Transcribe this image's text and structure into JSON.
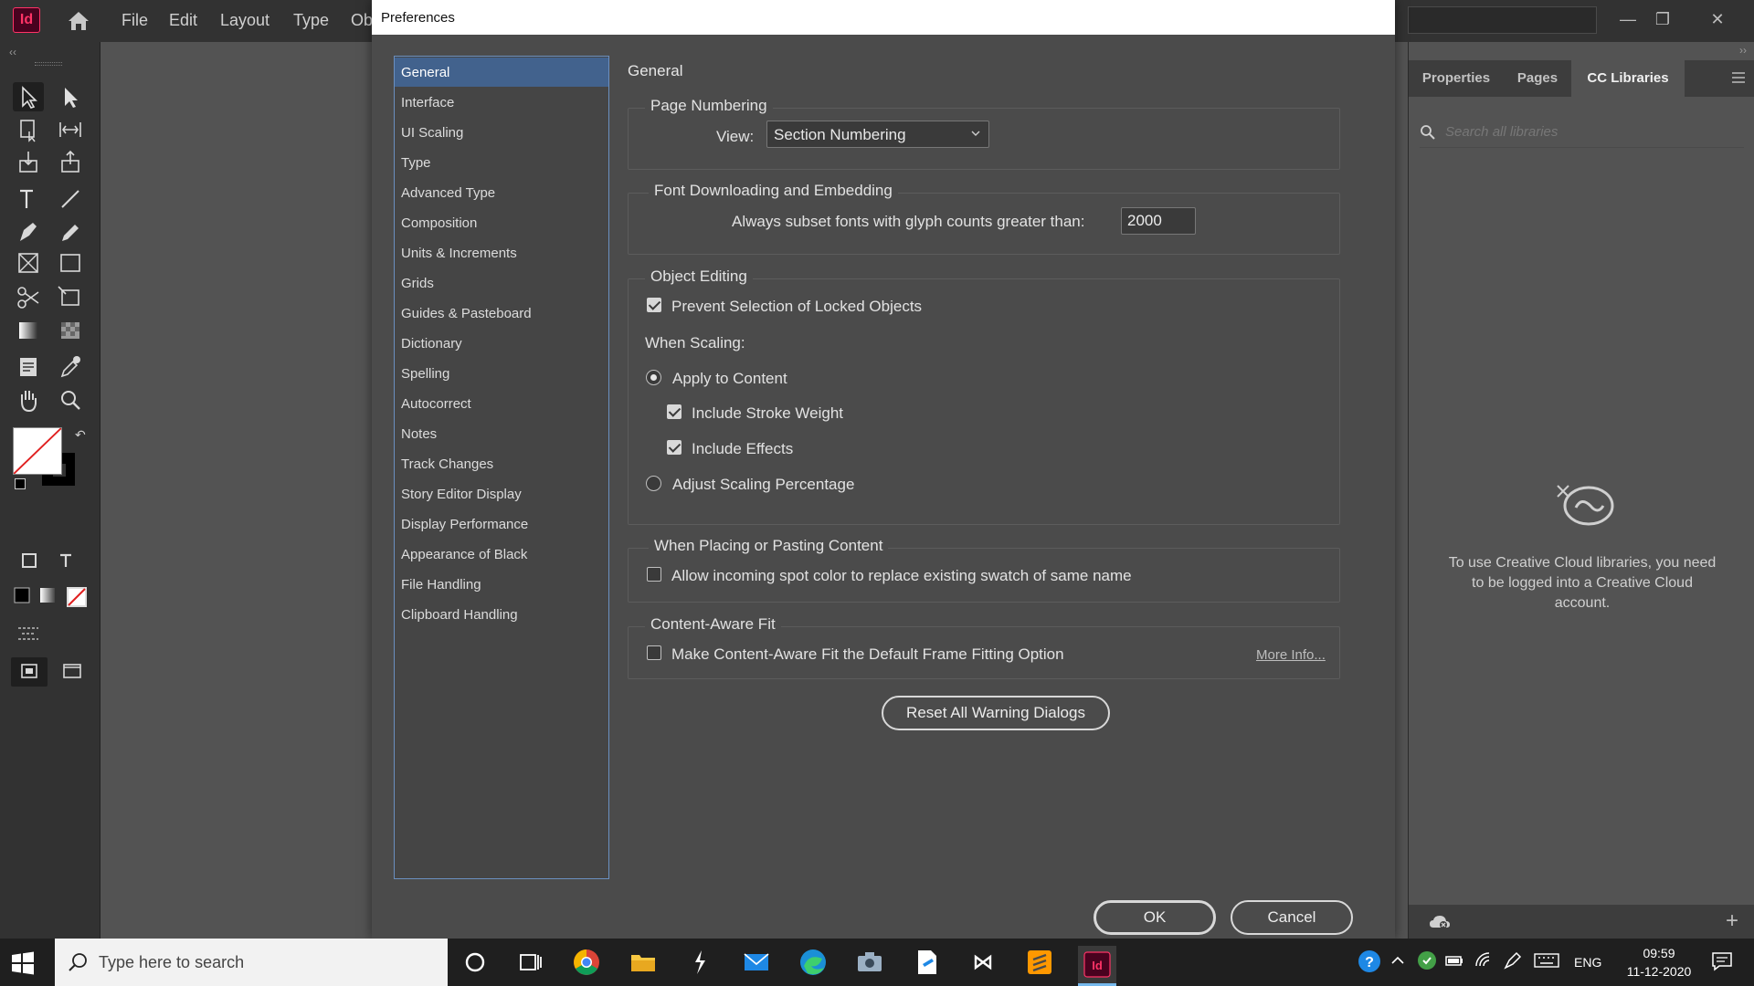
{
  "app": {
    "logo": "Id",
    "menu": [
      "File",
      "Edit",
      "Layout",
      "Type",
      "Ob"
    ]
  },
  "dialog": {
    "title": "Preferences",
    "categories": [
      "General",
      "Interface",
      "UI Scaling",
      "Type",
      "Advanced Type",
      "Composition",
      "Units & Increments",
      "Grids",
      "Guides & Pasteboard",
      "Dictionary",
      "Spelling",
      "Autocorrect",
      "Notes",
      "Track Changes",
      "Story Editor Display",
      "Display Performance",
      "Appearance of Black",
      "File Handling",
      "Clipboard Handling"
    ],
    "selected_category": "General",
    "section_heading": "General",
    "page_numbering": {
      "title": "Page Numbering",
      "view_label": "View:",
      "view_value": "Section Numbering"
    },
    "font_downloading": {
      "title": "Font Downloading and Embedding",
      "subset_label": "Always subset fonts with glyph counts greater than:",
      "subset_value": "2000"
    },
    "object_editing": {
      "title": "Object Editing",
      "prevent_selection": "Prevent Selection of Locked Objects",
      "prevent_selection_checked": true,
      "when_scaling": "When Scaling:",
      "apply_to_content": "Apply to Content",
      "apply_to_content_selected": true,
      "include_stroke": "Include Stroke Weight",
      "include_stroke_checked": true,
      "include_effects": "Include Effects",
      "include_effects_checked": true,
      "adjust_scaling": "Adjust Scaling Percentage",
      "adjust_scaling_selected": false
    },
    "placing": {
      "title": "When Placing or Pasting Content",
      "allow_spot": "Allow incoming spot color to replace existing swatch of same name",
      "allow_spot_checked": false
    },
    "content_aware": {
      "title": "Content-Aware Fit",
      "make_default": "Make Content-Aware Fit the Default Frame Fitting Option",
      "make_default_checked": false,
      "more_info": "More Info..."
    },
    "reset_button": "Reset All Warning Dialogs",
    "ok_button": "OK",
    "cancel_button": "Cancel"
  },
  "right_panel": {
    "tabs": [
      "Properties",
      "Pages",
      "CC Libraries"
    ],
    "active_tab": "CC Libraries",
    "search_placeholder": "Search all libraries",
    "message": "To use Creative Cloud libraries, you need to be logged into a Creative Cloud account."
  },
  "taskbar": {
    "search_placeholder": "Type here to search",
    "language": "ENG",
    "time": "09:59",
    "date": "11-12-2020"
  },
  "colors": {
    "accent": "#42628d",
    "app_brand": "#ff3366"
  }
}
